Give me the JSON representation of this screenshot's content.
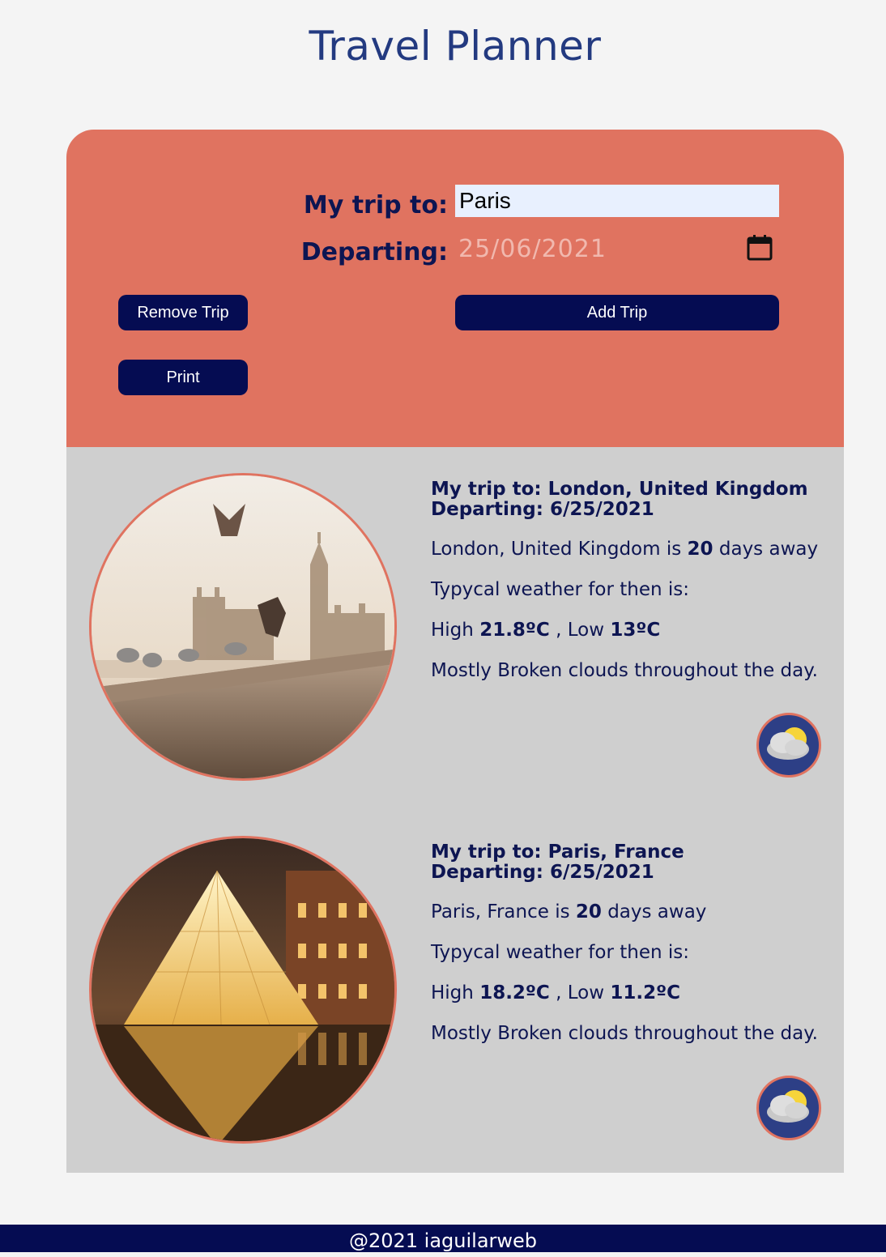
{
  "page": {
    "title": "Travel Planner"
  },
  "form": {
    "trip_label": "My trip to:",
    "trip_value": "Paris",
    "departing_label": "Departing:",
    "departing_value": "25/06/2021",
    "remove_label": "Remove Trip",
    "print_label": "Print",
    "add_label": "Add Trip"
  },
  "trips": [
    {
      "heading_trip": "My trip to: London, United Kingdom",
      "heading_departing": "Departing: 6/25/2021",
      "place": "London, United Kingdom",
      "is_text": "is",
      "days": "20",
      "days_text": "days away",
      "weather_intro": "Typycal weather for then is:",
      "high_label": "High",
      "high": "21.8ºC",
      "low_label": ", Low",
      "low": "13ºC",
      "description": "Mostly Broken clouds throughout the day.",
      "photo_icon": "london-skyline-photo",
      "weather_icon": "broken-clouds-icon"
    },
    {
      "heading_trip": "My trip to: Paris, France",
      "heading_departing": "Departing: 6/25/2021",
      "place": "Paris, France",
      "is_text": "is",
      "days": "20",
      "days_text": "days away",
      "weather_intro": "Typycal weather for then is:",
      "high_label": "High",
      "high": "18.2ºC",
      "low_label": ", Low",
      "low": "11.2ºC",
      "description": "Mostly Broken clouds throughout the day.",
      "photo_icon": "louvre-pyramid-photo",
      "weather_icon": "broken-clouds-icon"
    }
  ],
  "footer": {
    "text": "@2021 iaguilarweb"
  },
  "colors": {
    "title": "#233a80",
    "panel": "#e07360",
    "navy": "#050c52",
    "cards_bg": "#cfcfcf",
    "page_bg": "#f4f4f4"
  }
}
